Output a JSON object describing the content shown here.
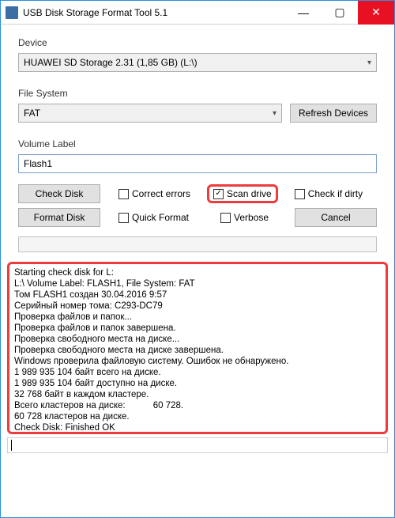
{
  "titlebar": {
    "title": "USB Disk Storage Format Tool 5.1"
  },
  "labels": {
    "device": "Device",
    "filesystem": "File System",
    "volumelabel": "Volume Label"
  },
  "device": {
    "selected": "HUAWEI  SD Storage  2.31 (1,85 GB) (L:\\)"
  },
  "filesystem": {
    "selected": "FAT"
  },
  "buttons": {
    "refresh": "Refresh Devices",
    "checkdisk": "Check Disk",
    "formatdisk": "Format Disk",
    "cancel": "Cancel"
  },
  "volume": {
    "value": "Flash1"
  },
  "checks": {
    "correct": "Correct errors",
    "scan": "Scan drive",
    "dirty": "Check if dirty",
    "quick": "Quick Format",
    "verbose": "Verbose"
  },
  "checkstates": {
    "correct": false,
    "scan": true,
    "dirty": false,
    "quick": false,
    "verbose": false
  },
  "log": "Starting check disk for L:\nL:\\ Volume Label: FLASH1, File System: FAT\nТом FLASH1 создан 30.04.2016 9:57\nСерийный номер тома: C293-DC79\nПроверка файлов и папок...\nПроверка файлов и папок завершена.\nПроверка свободного места на диске...\nПроверка свободного места на диске завершена.\nWindows проверила файловую систему. Ошибок не обнаружено.\n1 989 935 104 байт всего на диске.\n1 989 935 104 байт доступно на диске.\n32 768 байт в каждом кластере.\nВсего кластеров на диске:           60 728.\n60 728 кластеров на диске.\nCheck Disk: Finished OK"
}
